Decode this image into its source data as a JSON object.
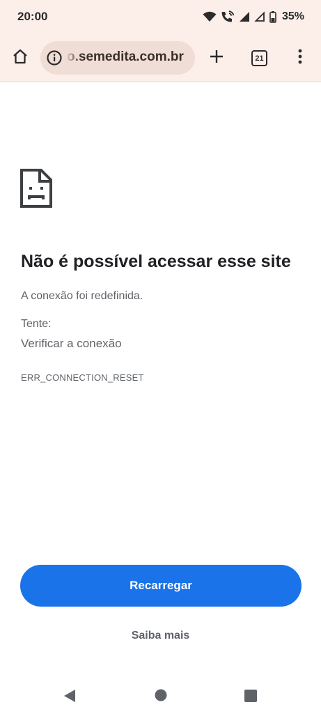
{
  "status_bar": {
    "time": "20:00",
    "battery": "35%",
    "icons": [
      "wifi-icon",
      "wifi-calling-icon",
      "signal-icon",
      "signal-empty-icon",
      "battery-icon"
    ]
  },
  "toolbar": {
    "url": "o.semedita.com.br",
    "tab_count": "21",
    "icons": [
      "home-icon",
      "info-icon",
      "plus-icon",
      "tabs-icon",
      "more-vert-icon"
    ]
  },
  "error_page": {
    "icon": "sad-page-icon",
    "title": "Não é possível acessar esse site",
    "description": "A conexão foi redefinida.",
    "try_label": "Tente:",
    "suggestion": "Verificar a conexão",
    "error_code": "ERR_CONNECTION_RESET",
    "reload_label": "Recarregar",
    "learn_more_label": "Saiba mais"
  },
  "nav_bar": {
    "icons": [
      "back-icon",
      "home-circle-icon",
      "recents-icon"
    ]
  },
  "colors": {
    "toolbar_bg": "#fcefe9",
    "url_bar_bg": "#f0ddd5",
    "primary_button": "#1a73e8",
    "secondary_text": "#5f6368"
  }
}
